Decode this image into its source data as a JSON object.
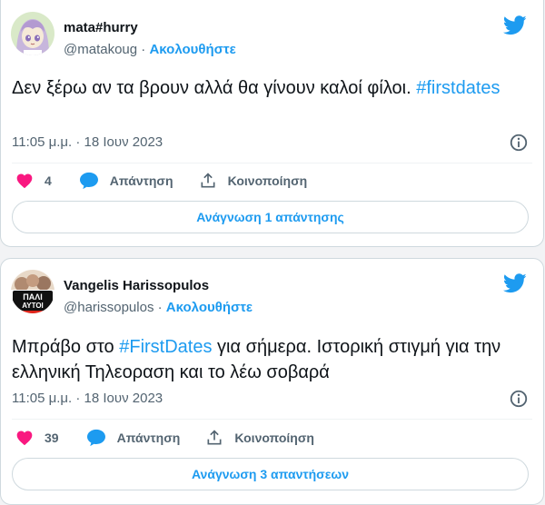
{
  "tweets": [
    {
      "author": {
        "name": "mata#hurry",
        "handle": "@matakoug",
        "separator": "·",
        "follow": "Ακολουθήστε"
      },
      "text_plain": "Δεν ξέρω αν τα βρουν αλλά θα γίνουν καλοί φίλοι.",
      "hashtag": "#firstdates",
      "timestamp": "11:05 μ.μ. · 18 Ιουν 2023",
      "likes": "4",
      "reply_label": "Απάντηση",
      "share_label": "Κοινοποίηση",
      "read_replies": "Ανάγνωση 1 απάντησης"
    },
    {
      "author": {
        "name": "Vangelis Harissopulos",
        "handle": "@harissopulos",
        "separator": "·",
        "follow": "Ακολουθήστε",
        "avatar_text": "ΠΑΛΙ ΑΥΤΟΙ"
      },
      "text_before": "Μπράβο στο ",
      "hashtag": "#FirstDates",
      "text_after": " για σήμερα. Ιστορική στιγμή για την ελληνική Τηλεοραση και το λέω σοβαρά",
      "timestamp": "11:05 μ.μ. · 18 Ιουν 2023",
      "likes": "39",
      "reply_label": "Απάντηση",
      "share_label": "Κοινοποίηση",
      "read_replies": "Ανάγνωση 3 απαντήσεων"
    }
  ],
  "colors": {
    "accent": "#1d9bf0",
    "like": "#f91880",
    "text": "#0f1419",
    "muted": "#536471"
  }
}
